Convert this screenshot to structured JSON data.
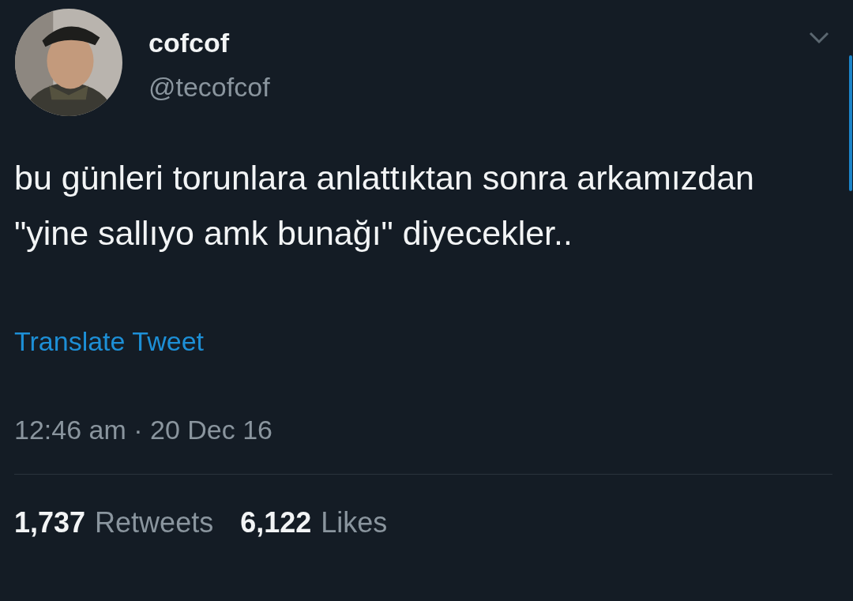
{
  "author": {
    "name": "cofcof",
    "handle": "@tecofcof"
  },
  "tweet": {
    "text": "bu günleri torunlara anlattıktan sonra arkamızdan \"yine sallıyo amk bunağı\" diyecekler..",
    "translate_link": "Translate Tweet",
    "timestamp": "12:46 am · 20 Dec 16"
  },
  "stats": [
    {
      "count": "1,737",
      "label": "Retweets"
    },
    {
      "count": "6,122",
      "label": "Likes"
    }
  ]
}
